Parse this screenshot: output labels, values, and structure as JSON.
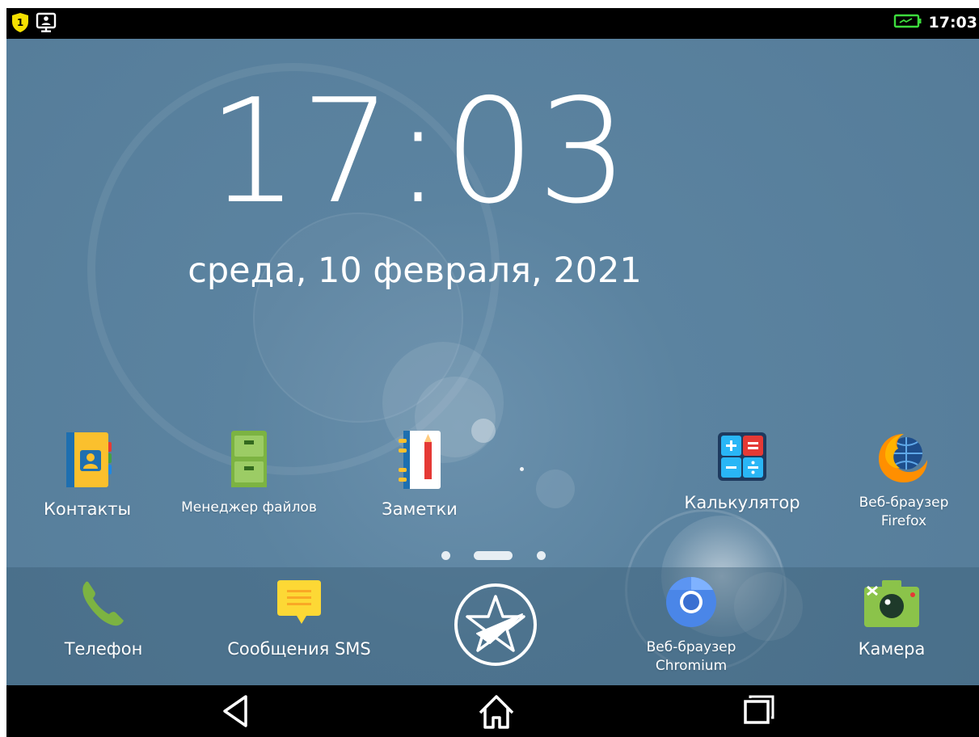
{
  "status_bar": {
    "time": "17:03",
    "notification_badge": "1",
    "icons": [
      "shield-warning-icon",
      "screen-share-icon",
      "battery-charging-icon"
    ]
  },
  "lockscreen": {
    "clock": "17:03",
    "date": "среда, 10 февраля, 2021"
  },
  "home_apps": [
    {
      "label": "Контакты",
      "icon": "contacts-icon"
    },
    {
      "label": "Менеджер файлов",
      "icon": "file-manager-icon"
    },
    {
      "label": "Заметки",
      "icon": "notes-icon"
    },
    {
      "label": "Калькулятор",
      "icon": "calculator-icon"
    },
    {
      "label_line1": "Веб-браузер",
      "label_line2": "Firefox",
      "icon": "firefox-icon"
    }
  ],
  "page_indicator": {
    "pages": 3,
    "current": 2
  },
  "dock": [
    {
      "label": "Телефон",
      "icon": "phone-icon"
    },
    {
      "label": "Сообщения SMS",
      "icon": "sms-icon"
    },
    {
      "label": "",
      "icon": "app-drawer-star-icon"
    },
    {
      "label_line1": "Веб-браузер",
      "label_line2": "Chromium",
      "icon": "chromium-icon"
    },
    {
      "label": "Камера",
      "icon": "camera-icon"
    }
  ],
  "nav_bar": {
    "icons": [
      "back-icon",
      "home-icon",
      "recents-icon"
    ]
  },
  "colors": {
    "wallpaper": "#5b83a0",
    "dock": "#4a6f8c",
    "status_bar": "#000000",
    "battery": "#3ddc3d",
    "shield": "#f5e000"
  }
}
